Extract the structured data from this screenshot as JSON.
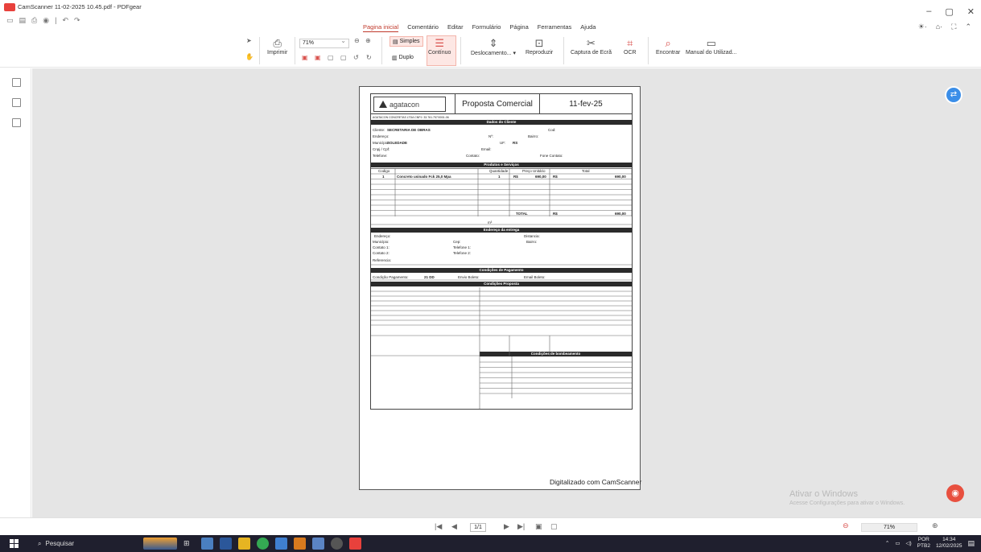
{
  "window": {
    "title": "CamScanner 11-02-2025 10.45.pdf - PDFgear",
    "controls": [
      "–",
      "▢",
      "✕"
    ],
    "right_controls": [
      "☀·",
      "⌂·",
      "⛶",
      "⌃"
    ]
  },
  "quick_access": [
    "▭",
    "▤",
    "⎙",
    "◉",
    "|",
    "↶",
    "↷"
  ],
  "menu": [
    "Pagina inicial",
    "Comentário",
    "Editar",
    "Formulário",
    "Página",
    "Ferramentas",
    "Ajuda"
  ],
  "ribbon": {
    "print": "Imprimir",
    "zoom": "71%",
    "simple": "Simples",
    "duplo": "Duplo",
    "continuo": "Contínuo",
    "deslocamento": "Deslocamento... ▾",
    "reproduzir": "Reproduzir",
    "captura": "Captura de Ecrã",
    "ocr": "OCR",
    "encontrar": "Encontrar",
    "manual": "Manual do Utilizad..."
  },
  "document": {
    "logo": "agatacon",
    "title": "Proposta Comercial",
    "date": "11-fev-25",
    "company_line": "AGATACON CONCRETAS LTDA     CNPJ: 33.761.757/0001-06",
    "sections": {
      "client": "Dados do Cliente",
      "products": "Produtos e Serviços",
      "delivery": "Endereço da entrega",
      "payment": "Condições de Pagamento",
      "proposal": "Condições Proposta",
      "pumping": "Condições de bombeamento"
    },
    "client_labels": {
      "cliente": "Cliente:",
      "cliente_val": "SECRETARIA DE OBRAS",
      "cod": "Cod:",
      "endereco": "Endereço:",
      "no": "Nº:",
      "bairro": "Bairro:",
      "municipio": "Município:",
      "municipio_val": "SOLEDADE",
      "uf": "UF:",
      "uf_val": "RS",
      "cnpj": "Cnpj / Cpf:",
      "email": "Email:",
      "telefone": "Telefone:",
      "contato": "Contato:",
      "fone_contato": "Fone Contato:"
    },
    "products_header": [
      "Codigo",
      "Quantidade",
      "Preço Unitário",
      "Total"
    ],
    "product_row": {
      "code": "1",
      "desc": "Concreto usinado Fck 25,0 Mpa",
      "qty": "1",
      "cur1": "R$",
      "unit": "690,00",
      "cur2": "R$",
      "total": "690,00"
    },
    "total_label": "TOTAL",
    "total_cur": "R$",
    "total_value": "690,00",
    "m3": "m³",
    "delivery_labels": {
      "endereco": "Endereço:",
      "distancia": "Distancia:",
      "municipio": "Município:",
      "cep": "Cep:",
      "bairro": "Bairro:",
      "contato1": "Contato 1:",
      "telefone1": "Telefone 1:",
      "contato2": "Contato 2:",
      "telefone2": "Telefone 2:",
      "referencia": "Referencia:"
    },
    "payment_labels": {
      "cond": "Condição Pagamento:",
      "cond_val": "21 DD",
      "envio": "Envio Boleto:",
      "email": "Email Boleto:"
    },
    "footer": "Digitalizado com CamScanner"
  },
  "activate": {
    "line1": "Ativar o Windows",
    "line2": "Acesse Configurações para ativar o Windows."
  },
  "status": {
    "page": "1/1",
    "zoom": "71%",
    "nav_first": "|◀",
    "nav_prev": "◀",
    "nav_next": "▶",
    "nav_last": "▶|",
    "zoom_out": "⊖",
    "zoom_in": "⊕"
  },
  "taskbar": {
    "search": "Pesquisar",
    "lang1": "POR",
    "lang2": "PTB2",
    "time": "14:34",
    "date": "12/02/2025"
  }
}
